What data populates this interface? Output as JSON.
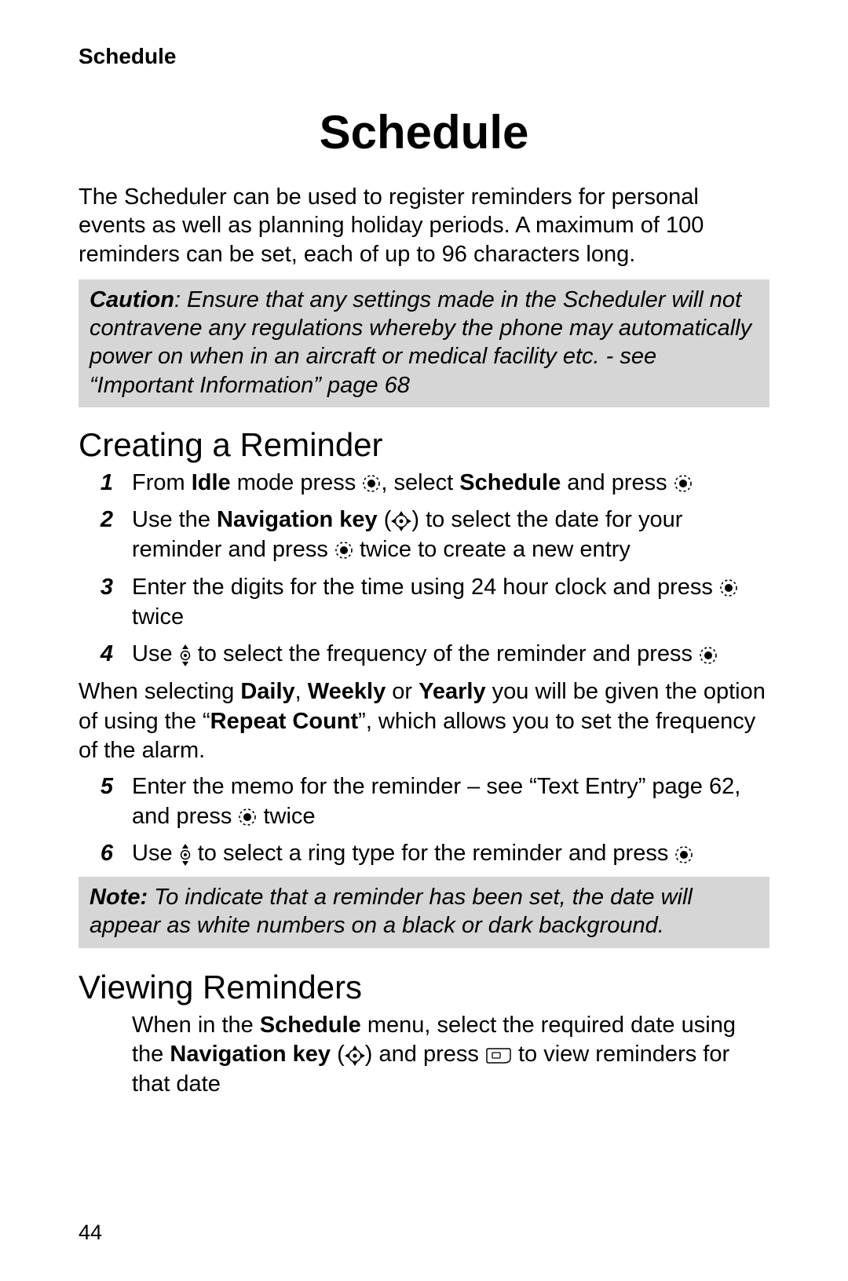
{
  "running_header": "Schedule",
  "chapter_title": "Schedule",
  "intro": "The Scheduler can be used to register reminders for personal events as well as planning holiday periods. A maximum of 100 reminders can be set, each of up to 96 characters long.",
  "caution": {
    "label": "Caution",
    "body": ": Ensure that any settings made in the Scheduler will not contravene any regulations whereby the phone may automatically power on when in an aircraft or medical facility etc. - see “Important Information” page 68"
  },
  "section_creating": "Creating a Reminder",
  "steps1": {
    "n1": "1",
    "s1a": "From ",
    "s1b": "Idle",
    "s1c": " mode press ",
    "s1d": ", select ",
    "s1e": "Schedule",
    "s1f": " and press ",
    "n2": "2",
    "s2a": "Use the ",
    "s2b": "Navigation key",
    "s2c": " (",
    "s2d": ") to select the date for your reminder and press ",
    "s2e": " twice to create a new entry",
    "n3": "3",
    "s3a": "Enter the digits for the time using 24 hour clock and press ",
    "s3b": " twice",
    "n4": "4",
    "s4a": "Use ",
    "s4b": " to select the frequency of the reminder and press "
  },
  "mid_paragraph": {
    "a": "When selecting ",
    "b": "Daily",
    "c": ", ",
    "d": "Weekly",
    "e": " or ",
    "f": "Yearly",
    "g": " you will be given the option of using the “",
    "h": "Repeat Count",
    "i": "”, which allows you to set the frequency of the alarm."
  },
  "steps2": {
    "n5": "5",
    "s5a": "Enter the memo for the reminder – see “Text Entry” page 62, and press ",
    "s5b": " twice",
    "n6": "6",
    "s6a": "Use ",
    "s6b": " to select a ring type for the reminder and press "
  },
  "note": {
    "label": "Note:",
    "body": " To indicate that a reminder has been set, the date will appear as white numbers on a black or dark background."
  },
  "section_viewing": "Viewing Reminders",
  "viewing": {
    "a": "When in the ",
    "b": "Schedule",
    "c": " menu, select the required date using the ",
    "d": "Navigation key",
    "e": " (",
    "f": ") and press ",
    "g": " to view reminders for that date"
  },
  "page_number": "44"
}
